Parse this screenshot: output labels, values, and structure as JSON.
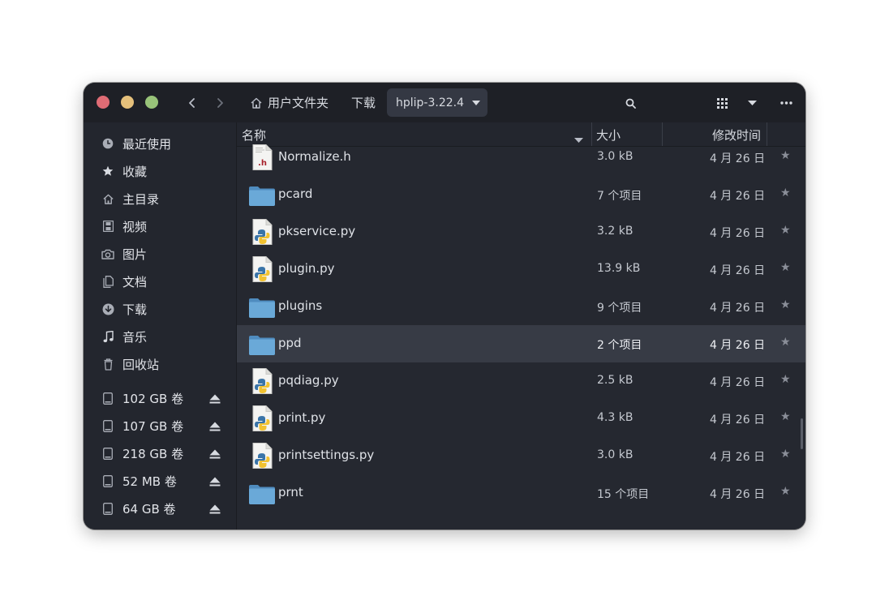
{
  "header": {
    "breadcrumb": {
      "home": "用户文件夹",
      "downloads": "下载",
      "current": "hplip-3.22.4"
    }
  },
  "sidebar": {
    "places": [
      {
        "label": "最近使用",
        "icon": "clock-icon"
      },
      {
        "label": "收藏",
        "icon": "star-icon"
      },
      {
        "label": "主目录",
        "icon": "home-icon"
      },
      {
        "label": "视频",
        "icon": "film-icon"
      },
      {
        "label": "图片",
        "icon": "camera-icon"
      },
      {
        "label": "文档",
        "icon": "document-icon"
      },
      {
        "label": "下载",
        "icon": "download-icon"
      },
      {
        "label": "音乐",
        "icon": "music-icon"
      },
      {
        "label": "回收站",
        "icon": "trash-icon"
      }
    ],
    "volumes": [
      {
        "label": "102 GB 卷"
      },
      {
        "label": "107 GB 卷"
      },
      {
        "label": "218 GB 卷"
      },
      {
        "label": "52 MB 卷"
      },
      {
        "label": "64 GB 卷"
      }
    ]
  },
  "columns": {
    "name": "名称",
    "size": "大小",
    "modified": "修改时间"
  },
  "files": [
    {
      "name": "Normalize.h",
      "size": "3.0 kB",
      "modified": "4 月 26 日",
      "type": "header",
      "selected": false
    },
    {
      "name": "pcard",
      "size": "7 个项目",
      "modified": "4 月 26 日",
      "type": "folder",
      "selected": false
    },
    {
      "name": "pkservice.py",
      "size": "3.2 kB",
      "modified": "4 月 26 日",
      "type": "python",
      "selected": false
    },
    {
      "name": "plugin.py",
      "size": "13.9 kB",
      "modified": "4 月 26 日",
      "type": "python",
      "selected": false
    },
    {
      "name": "plugins",
      "size": "9 个项目",
      "modified": "4 月 26 日",
      "type": "folder",
      "selected": false
    },
    {
      "name": "ppd",
      "size": "2 个项目",
      "modified": "4 月 26 日",
      "type": "folder",
      "selected": true
    },
    {
      "name": "pqdiag.py",
      "size": "2.5 kB",
      "modified": "4 月 26 日",
      "type": "python",
      "selected": false
    },
    {
      "name": "print.py",
      "size": "4.3 kB",
      "modified": "4 月 26 日",
      "type": "python",
      "selected": false
    },
    {
      "name": "printsettings.py",
      "size": "3.0 kB",
      "modified": "4 月 26 日",
      "type": "python",
      "selected": false
    },
    {
      "name": "prnt",
      "size": "15 个项目",
      "modified": "4 月 26 日",
      "type": "folder",
      "selected": false
    }
  ],
  "colors": {
    "window_bg": "#252830",
    "headerbar_bg": "#1e2026",
    "selected_row": "#373b45",
    "folder": "#6aa9d8",
    "close": "#e06c75",
    "minimize": "#e5c07b",
    "maximize": "#98c379"
  }
}
